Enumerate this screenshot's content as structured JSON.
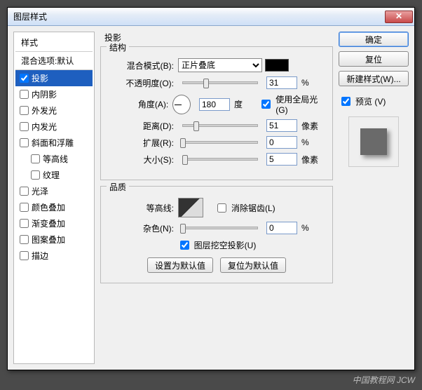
{
  "window": {
    "title": "图层样式"
  },
  "left": {
    "styles_header": "样式",
    "blend_defaults": "混合选项:默认",
    "items": [
      {
        "label": "投影",
        "checked": true,
        "selected": true
      },
      {
        "label": "内阴影",
        "checked": false
      },
      {
        "label": "外发光",
        "checked": false
      },
      {
        "label": "内发光",
        "checked": false
      },
      {
        "label": "斜面和浮雕",
        "checked": false
      },
      {
        "label": "等高线",
        "checked": false,
        "indent": true
      },
      {
        "label": "纹理",
        "checked": false,
        "indent": true
      },
      {
        "label": "光泽",
        "checked": false
      },
      {
        "label": "颜色叠加",
        "checked": false
      },
      {
        "label": "渐变叠加",
        "checked": false
      },
      {
        "label": "图案叠加",
        "checked": false
      },
      {
        "label": "描边",
        "checked": false
      }
    ]
  },
  "panel": {
    "title": "投影",
    "structure": {
      "legend": "结构",
      "blend_mode_label": "混合模式(B):",
      "blend_mode_value": "正片叠底",
      "color": "#000000",
      "opacity_label": "不透明度(O):",
      "opacity_value": "31",
      "opacity_unit": "%",
      "angle_label": "角度(A):",
      "angle_value": "180",
      "angle_unit": "度",
      "global_light_label": "使用全局光(G)",
      "global_light_checked": true,
      "distance_label": "距离(D):",
      "distance_value": "51",
      "distance_unit": "像素",
      "spread_label": "扩展(R):",
      "spread_value": "0",
      "spread_unit": "%",
      "size_label": "大小(S):",
      "size_value": "5",
      "size_unit": "像素"
    },
    "quality": {
      "legend": "品质",
      "contour_label": "等高线:",
      "antialias_label": "消除锯齿(L)",
      "antialias_checked": false,
      "noise_label": "杂色(N):",
      "noise_value": "0",
      "noise_unit": "%"
    },
    "knockout_label": "图层挖空投影(U)",
    "knockout_checked": true,
    "make_default": "设置为默认值",
    "reset_default": "复位为默认值"
  },
  "right": {
    "ok": "确定",
    "cancel": "复位",
    "new_style": "新建样式(W)...",
    "preview_label": "预览 (V)",
    "preview_checked": true
  },
  "watermark": "中国教程网 JCW"
}
